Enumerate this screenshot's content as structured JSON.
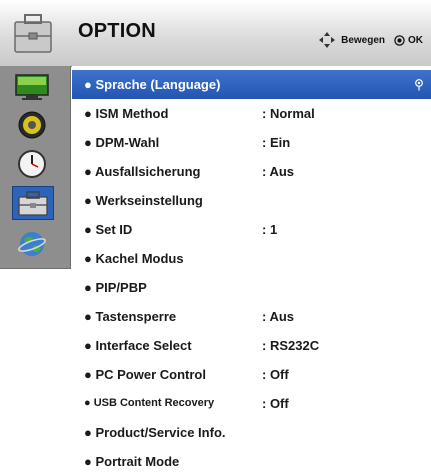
{
  "header": {
    "title": "OPTION",
    "move_hint": "Bewegen",
    "ok_hint": "OK",
    "icon": "toolbox-icon"
  },
  "sidebar": {
    "items": [
      {
        "name": "picture-icon"
      },
      {
        "name": "audio-icon"
      },
      {
        "name": "time-icon"
      },
      {
        "name": "option-toolbox-icon",
        "active": true
      },
      {
        "name": "network-globe-icon"
      }
    ]
  },
  "menu": {
    "items": [
      {
        "label": "● Sprache (Language)",
        "value": ""
      },
      {
        "label": "● ISM Method",
        "value": ": Normal"
      },
      {
        "label": "● DPM-Wahl",
        "value": ": Ein"
      },
      {
        "label": "● Ausfallsicherung",
        "value": ": Aus"
      },
      {
        "label": "● Werkseinstellung",
        "value": ""
      },
      {
        "label": "● Set ID",
        "value": ": 1"
      },
      {
        "label": "● Kachel Modus",
        "value": ""
      },
      {
        "label": "● PIP/PBP",
        "value": ""
      },
      {
        "label": "● Tastensperre",
        "value": ": Aus"
      },
      {
        "label": "● Interface Select",
        "value": ": RS232C"
      },
      {
        "label": "● PC Power Control",
        "value": ": Off"
      },
      {
        "label": "● USB Content Recovery",
        "value": ": Off"
      },
      {
        "label": "● Product/Service Info.",
        "value": ""
      },
      {
        "label": "● Portrait Mode",
        "value": ""
      }
    ],
    "selected_index": 0
  },
  "colors": {
    "selected": "#2d63b8",
    "sidebar": "#8e8e8e"
  }
}
